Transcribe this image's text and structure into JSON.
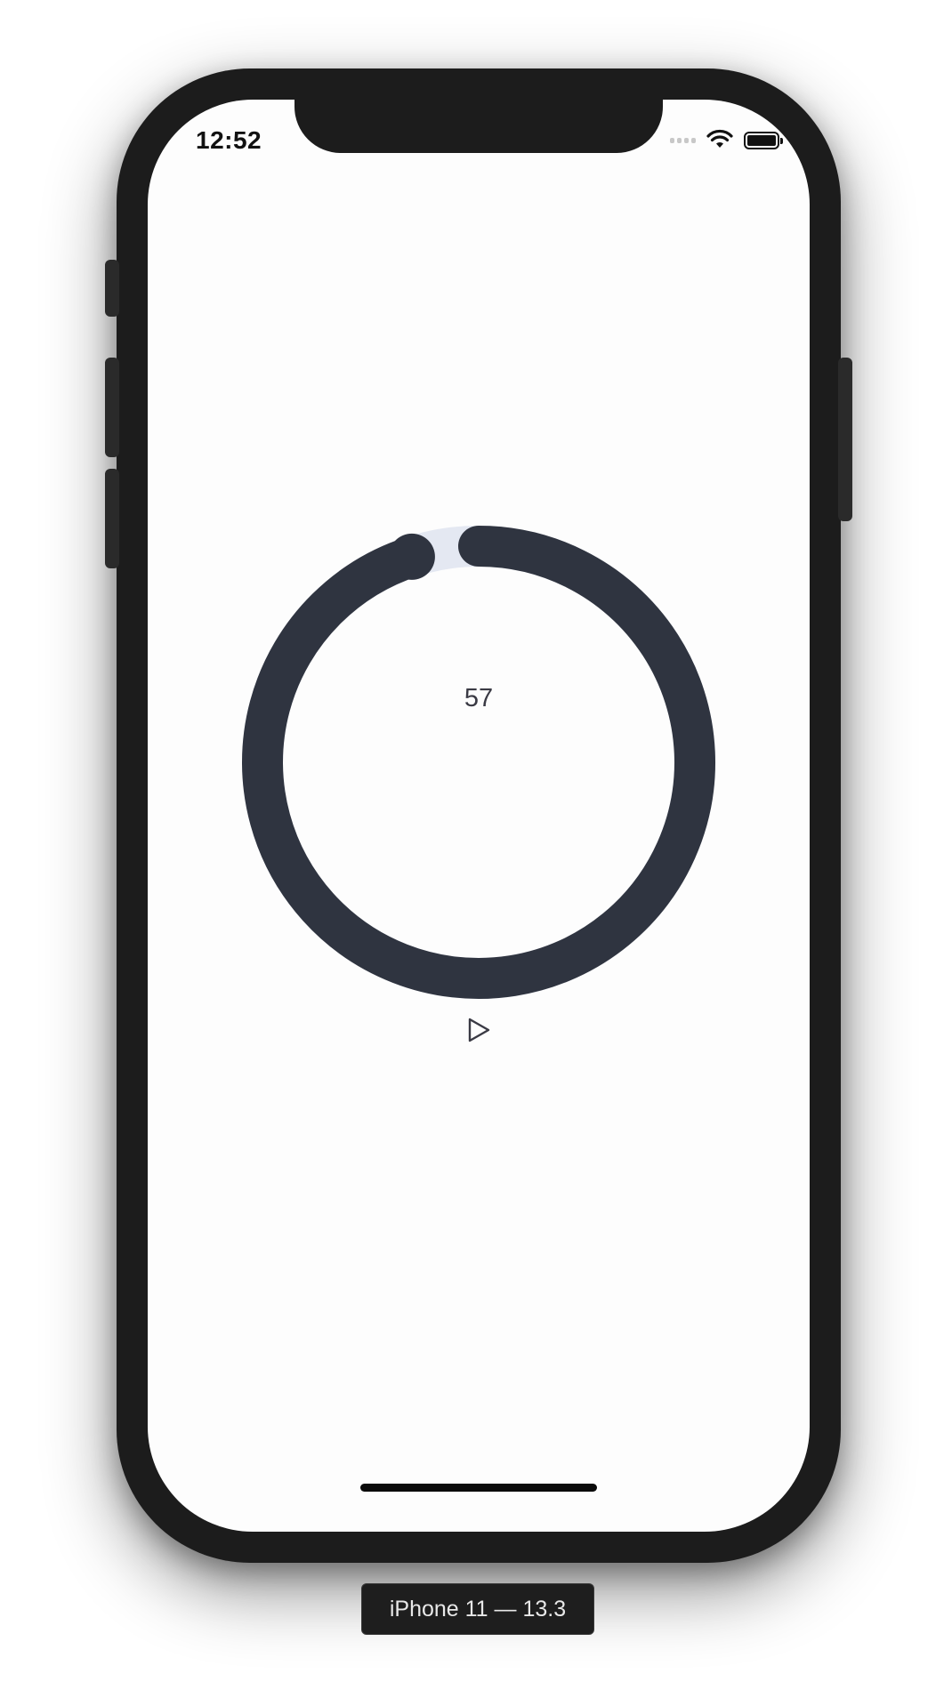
{
  "status_bar": {
    "time": "12:52",
    "icons": [
      "cellular-signal-icon",
      "wifi-icon",
      "battery-icon"
    ]
  },
  "timer": {
    "value": "57",
    "progress_fraction": 0.95,
    "track_color": "#e4e8f2",
    "progress_color": "#2f3440"
  },
  "controls": {
    "play_icon": "play-icon"
  },
  "device_label": "iPhone 11 — 13.3",
  "colors": {
    "device_frame": "#1c1c1c",
    "screen_background": "#fdfdfd",
    "text": "#3a3a44"
  }
}
